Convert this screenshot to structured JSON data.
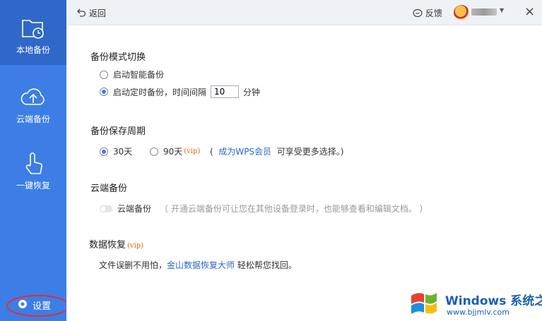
{
  "sidebar": {
    "items": [
      {
        "label": "本地备份",
        "icon": "folder-clock-icon",
        "active": true
      },
      {
        "label": "云端备份",
        "icon": "cloud-upload-icon",
        "active": false
      },
      {
        "label": "一键恢复",
        "icon": "hand-pointer-icon",
        "active": false
      }
    ],
    "settings_label": "设置",
    "colors": {
      "bg": "#3c7ee6",
      "active": "#2f68c9",
      "highlight": "#e62d2d"
    }
  },
  "topbar": {
    "back_label": "返回",
    "feedback_label": "反馈",
    "close_label": "×"
  },
  "backup_mode": {
    "title": "备份模式切换",
    "smart_label": "启动智能备份",
    "timed_label": "启动定时备份，时间间隔",
    "interval_value": "10",
    "interval_unit": "分钟",
    "selected": "timed"
  },
  "retention": {
    "title": "备份保存周期",
    "opt30": "30天",
    "opt90": "90天",
    "vip": "(vip)",
    "hint_open": "(",
    "hint_link": "成为WPS会员",
    "hint_rest": "可享受更多选择。)",
    "selected": "30"
  },
  "cloud": {
    "title": "云端备份",
    "toggle_label": "云端备份",
    "toggle_on": false,
    "hint": "（ 开通云端备份可让您在其他设备登录时，也能够查看和编辑文档。 ）"
  },
  "recovery": {
    "title": "数据恢复",
    "vip": "(vip)",
    "text_before": "文件误删不用怕，",
    "link": "金山数据恢复大师",
    "text_after": "轻松帮您找回。"
  },
  "watermark": {
    "line1": "Windows 系统之家",
    "line2": "www.bjjmlv.com"
  }
}
